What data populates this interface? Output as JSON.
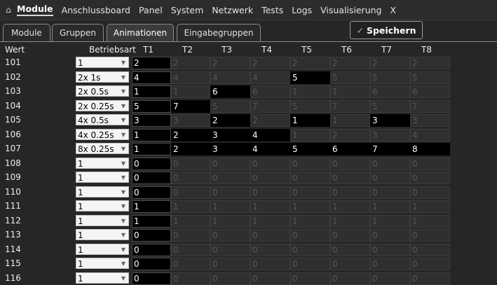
{
  "nav": {
    "home_icon": "⌂",
    "items": [
      "Module",
      "Anschlussboard",
      "Panel",
      "System",
      "Netzwerk",
      "Tests",
      "Logs",
      "Visualisierung",
      "X"
    ],
    "active": "Module"
  },
  "subtabs": {
    "items": [
      "Module",
      "Gruppen",
      "Animationen",
      "Eingabegruppen"
    ],
    "active": "Animationen"
  },
  "save_button": {
    "icon": "✓",
    "label": "Speichern",
    "icon_color": "#7ac943"
  },
  "table": {
    "headers": {
      "wert": "Wert",
      "betriebsart": "Betriebsart",
      "t": [
        "T1",
        "T2",
        "T3",
        "T4",
        "T5",
        "T6",
        "T7",
        "T8"
      ]
    },
    "rows": [
      {
        "wert": "101",
        "mode": "1",
        "t": [
          "2",
          "2",
          "2",
          "2",
          "2",
          "2",
          "2",
          "2"
        ],
        "active": [
          0
        ]
      },
      {
        "wert": "102",
        "mode": "2x 1s",
        "t": [
          "4",
          "4",
          "4",
          "4",
          "5",
          "5",
          "5",
          "5"
        ],
        "active": [
          0,
          4
        ]
      },
      {
        "wert": "103",
        "mode": "2x 0.5s",
        "t": [
          "1",
          "1",
          "6",
          "6",
          "1",
          "1",
          "6",
          "6"
        ],
        "active": [
          0,
          2
        ]
      },
      {
        "wert": "104",
        "mode": "2x 0.25s",
        "t": [
          "5",
          "7",
          "5",
          "7",
          "5",
          "7",
          "5",
          "7"
        ],
        "active": [
          0,
          1
        ]
      },
      {
        "wert": "105",
        "mode": "4x 0.5s",
        "t": [
          "3",
          "3",
          "2",
          "2",
          "1",
          "1",
          "3",
          "3"
        ],
        "active": [
          0,
          2,
          4,
          6
        ]
      },
      {
        "wert": "106",
        "mode": "4x 0.25s",
        "t": [
          "1",
          "2",
          "3",
          "4",
          "1",
          "2",
          "3",
          "4"
        ],
        "active": [
          0,
          1,
          2,
          3
        ]
      },
      {
        "wert": "107",
        "mode": "8x 0.25s",
        "t": [
          "1",
          "2",
          "3",
          "4",
          "5",
          "6",
          "7",
          "8"
        ],
        "active": [
          0,
          1,
          2,
          3,
          4,
          5,
          6,
          7
        ]
      },
      {
        "wert": "108",
        "mode": "1",
        "t": [
          "0",
          "0",
          "0",
          "0",
          "0",
          "0",
          "0",
          "0"
        ],
        "active": [
          0
        ]
      },
      {
        "wert": "109",
        "mode": "1",
        "t": [
          "0",
          "0",
          "0",
          "0",
          "0",
          "0",
          "0",
          "0"
        ],
        "active": [
          0
        ]
      },
      {
        "wert": "110",
        "mode": "1",
        "t": [
          "0",
          "0",
          "0",
          "0",
          "0",
          "0",
          "0",
          "0"
        ],
        "active": [
          0
        ]
      },
      {
        "wert": "111",
        "mode": "1",
        "t": [
          "1",
          "1",
          "1",
          "1",
          "1",
          "1",
          "1",
          "1"
        ],
        "active": [
          0
        ]
      },
      {
        "wert": "112",
        "mode": "1",
        "t": [
          "1",
          "1",
          "1",
          "1",
          "1",
          "1",
          "1",
          "1"
        ],
        "active": [
          0
        ]
      },
      {
        "wert": "113",
        "mode": "1",
        "t": [
          "0",
          "0",
          "0",
          "0",
          "0",
          "0",
          "0",
          "0"
        ],
        "active": [
          0
        ]
      },
      {
        "wert": "114",
        "mode": "1",
        "t": [
          "0",
          "0",
          "0",
          "0",
          "0",
          "0",
          "0",
          "0"
        ],
        "active": [
          0
        ]
      },
      {
        "wert": "115",
        "mode": "1",
        "t": [
          "0",
          "0",
          "0",
          "0",
          "0",
          "0",
          "0",
          "0"
        ],
        "active": [
          0
        ]
      },
      {
        "wert": "116",
        "mode": "1",
        "t": [
          "0",
          "0",
          "0",
          "0",
          "0",
          "0",
          "0",
          "0"
        ],
        "active": [
          0
        ]
      }
    ]
  }
}
